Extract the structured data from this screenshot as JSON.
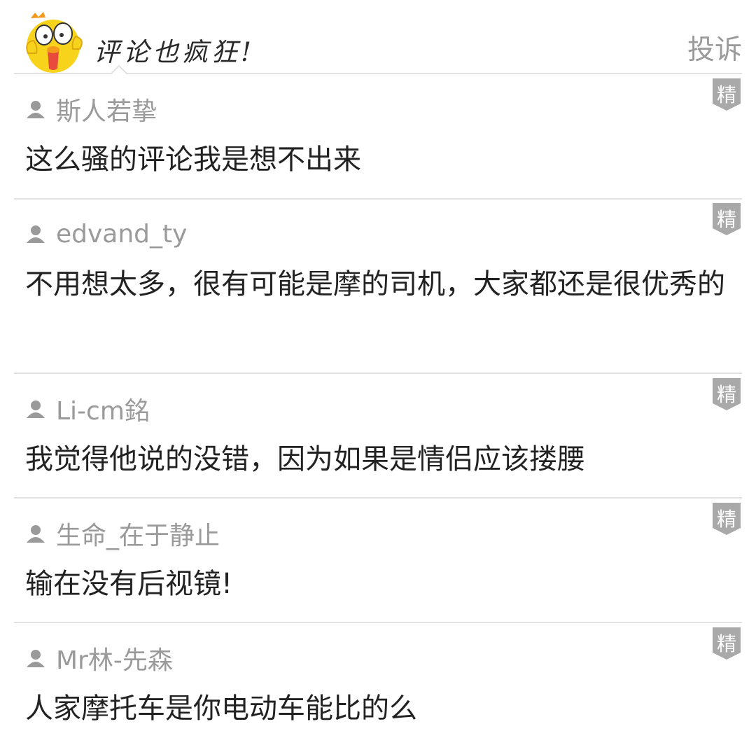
{
  "header": {
    "title": "评论也疯狂!",
    "report_label": "投诉",
    "mascot_icon": "yellow-chick-mascot"
  },
  "badge_label": "精",
  "comments": [
    {
      "user": "斯人若挚",
      "text": "这么骚的评论我是想不出来"
    },
    {
      "user": "edvand_ty",
      "text": "不用想太多，很有可能是摩的司机，大家都还是很优秀的"
    },
    {
      "user": "Li-cm銘",
      "text": "我觉得他说的没错，因为如果是情侣应该搂腰"
    },
    {
      "user": "生命_在于静止",
      "text": "输在没有后视镜!"
    },
    {
      "user": "Mr林-先森",
      "text": "人家摩托车是你电动车能比的么"
    }
  ],
  "colors": {
    "accent_yellow": "#f8d31c",
    "badge_gray": "#a9a9a9",
    "muted_text": "#9a9a9a",
    "body_text": "#222222",
    "divider": "#e2e2e2"
  }
}
